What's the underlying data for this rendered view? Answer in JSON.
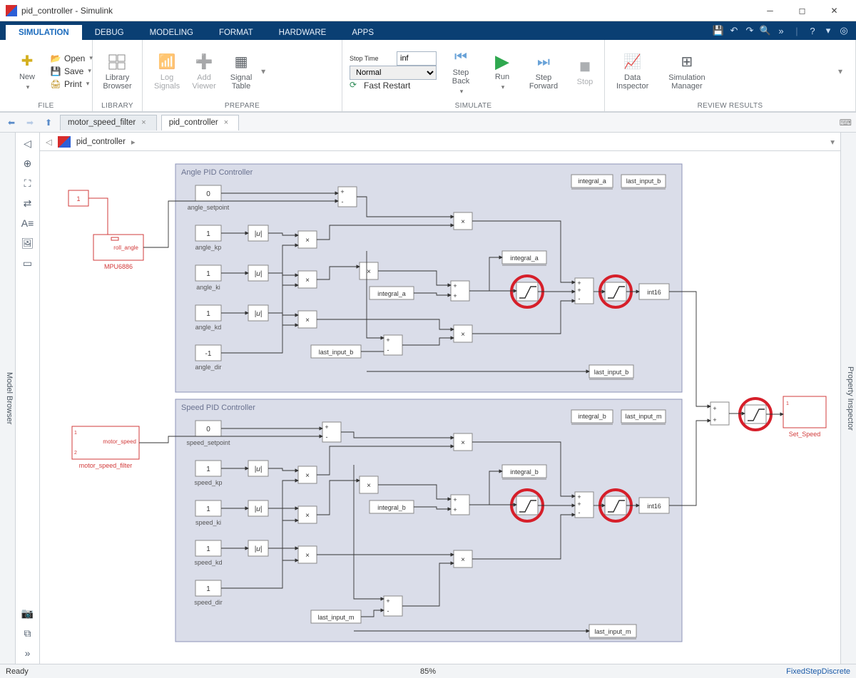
{
  "window": {
    "title": "pid_controller - Simulink"
  },
  "tabs": {
    "items": [
      "SIMULATION",
      "DEBUG",
      "MODELING",
      "FORMAT",
      "HARDWARE",
      "APPS"
    ],
    "active": 0
  },
  "ribbon": {
    "file": {
      "new": "New",
      "open": "Open",
      "save": "Save",
      "print": "Print",
      "group": "FILE"
    },
    "library": {
      "label": "Library\nBrowser",
      "group": "LIBRARY"
    },
    "prepare": {
      "log": "Log\nSignals",
      "add": "Add\nViewer",
      "signal": "Signal\nTable",
      "group": "PREPARE"
    },
    "sim": {
      "stoptime_label": "Stop Time",
      "stoptime": "inf",
      "mode": "Normal",
      "fast": "Fast Restart",
      "stepback": "Step\nBack",
      "run": "Run",
      "stepfwd": "Step\nForward",
      "stop": "Stop",
      "group": "SIMULATE"
    },
    "review": {
      "di": "Data\nInspector",
      "sm": "Simulation\nManager",
      "group": "REVIEW RESULTS"
    }
  },
  "filetabs": {
    "items": [
      "motor_speed_filter",
      "pid_controller"
    ],
    "active": 1
  },
  "breadcrumb": {
    "path": "pid_controller"
  },
  "sidebar_left": "Model Browser",
  "sidebar_right": "Property Inspector",
  "canvas": {
    "subsystem_a": {
      "title": "Angle PID Controller",
      "blocks": {
        "setpoint": {
          "v": "0",
          "l": "angle_setpoint"
        },
        "kp": {
          "v": "1",
          "l": "angle_kp"
        },
        "ki": {
          "v": "1",
          "l": "angle_ki"
        },
        "kd": {
          "v": "1",
          "l": "angle_kd"
        },
        "dir": {
          "v": "-1",
          "l": "angle_dir"
        },
        "integral": "integral_a",
        "lastinput": "last_input_b",
        "store_i": "integral_a",
        "store_l": "last_input_b",
        "cast": "int16",
        "abs": "|u|"
      }
    },
    "subsystem_b": {
      "title": "Speed PID Controller",
      "blocks": {
        "setpoint": {
          "v": "0",
          "l": "speed_setpoint"
        },
        "kp": {
          "v": "1",
          "l": "speed_kp"
        },
        "ki": {
          "v": "1",
          "l": "speed_ki"
        },
        "kd": {
          "v": "1",
          "l": "speed_kd"
        },
        "dir": {
          "v": "1",
          "l": "speed_dir"
        },
        "integral": "integral_b",
        "lastinput": "last_input_m",
        "store_i": "integral_b",
        "store_l": "last_input_m",
        "cast": "int16",
        "abs": "|u|"
      }
    },
    "inputs": {
      "mpu": {
        "name": "roll_angle",
        "sub": "MPU6886"
      },
      "msf": {
        "name": "motor_speed",
        "sub": "motor_speed_filter"
      }
    },
    "output": {
      "name": "Set_Speed"
    },
    "mult": "×"
  },
  "status": {
    "ready": "Ready",
    "zoom": "85%",
    "solver": "FixedStepDiscrete"
  }
}
